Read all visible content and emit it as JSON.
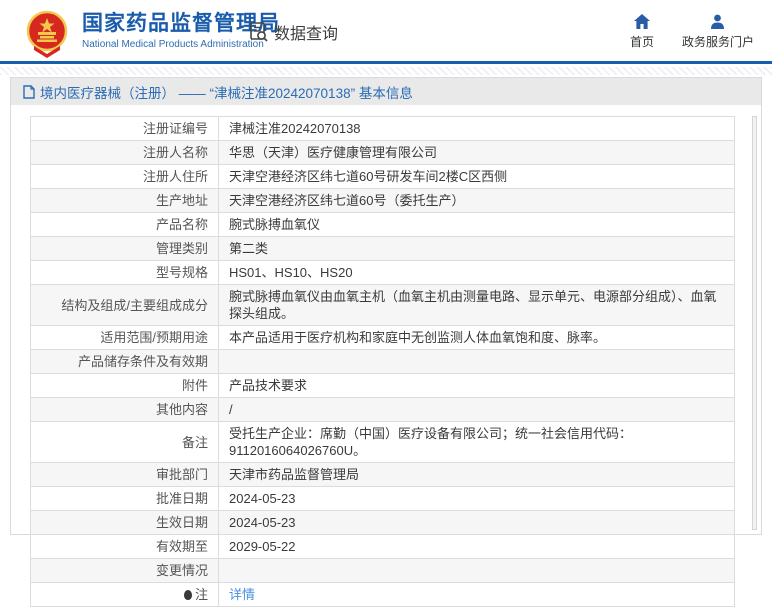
{
  "header": {
    "brand_title": "国家药品监督管理局",
    "brand_subtitle": "National Medical Products Administration",
    "query_label": "数据查询",
    "nav": [
      {
        "label": "首页",
        "icon": "home-icon"
      },
      {
        "label": "政务服务门户",
        "icon": "user-icon"
      }
    ]
  },
  "page": {
    "title": "境内医疗器械（注册） —— “津械注准20242070138” 基本信息"
  },
  "table": {
    "rows": [
      {
        "label": "注册证编号",
        "value": "津械注准20242070138"
      },
      {
        "label": "注册人名称",
        "value": "华思（天津）医疗健康管理有限公司"
      },
      {
        "label": "注册人住所",
        "value": "天津空港经济区纬七道60号研发车间2楼C区西侧"
      },
      {
        "label": "生产地址",
        "value": "天津空港经济区纬七道60号（委托生产）"
      },
      {
        "label": "产品名称",
        "value": "腕式脉搏血氧仪"
      },
      {
        "label": "管理类别",
        "value": "第二类"
      },
      {
        "label": "型号规格",
        "value": "HS01、HS10、HS20"
      },
      {
        "label": "结构及组成/主要组成成分",
        "value": "腕式脉搏血氧仪由血氧主机（血氧主机由测量电路、显示单元、电源部分组成）、血氧探头组成。"
      },
      {
        "label": "适用范围/预期用途",
        "value": "本产品适用于医疗机构和家庭中无创监测人体血氧饱和度、脉率。"
      },
      {
        "label": "产品储存条件及有效期",
        "value": ""
      },
      {
        "label": "附件",
        "value": "产品技术要求"
      },
      {
        "label": "其他内容",
        "value": "/"
      },
      {
        "label": "备注",
        "value": "受托生产企业：席勤（中国）医疗设备有限公司；统一社会信用代码：9112016064026760U。"
      },
      {
        "label": "审批部门",
        "value": "天津市药品监督管理局"
      },
      {
        "label": "批准日期",
        "value": "2024-05-23"
      },
      {
        "label": "生效日期",
        "value": "2024-05-23"
      },
      {
        "label": "有效期至",
        "value": "2029-05-22"
      },
      {
        "label": "变更情况",
        "value": ""
      },
      {
        "label": "注",
        "value": "详情",
        "link": true,
        "note_icon": true
      }
    ]
  },
  "icons": {
    "brand": "national-emblem",
    "query": "doc-search-icon",
    "title": "document-icon",
    "note": "balloon-note-icon"
  },
  "colors": {
    "accent_blue": "#1a5cab",
    "header_border": "#1660ab",
    "titlebar_bg": "#e9e9e9",
    "title_text": "#2a6cb5",
    "link": "#4a90e2",
    "row_alt_bg": "#f6f6f6",
    "table_border": "#c6c6c6",
    "emblem_red": "#d7281f",
    "emblem_gold": "#f2c94c"
  }
}
